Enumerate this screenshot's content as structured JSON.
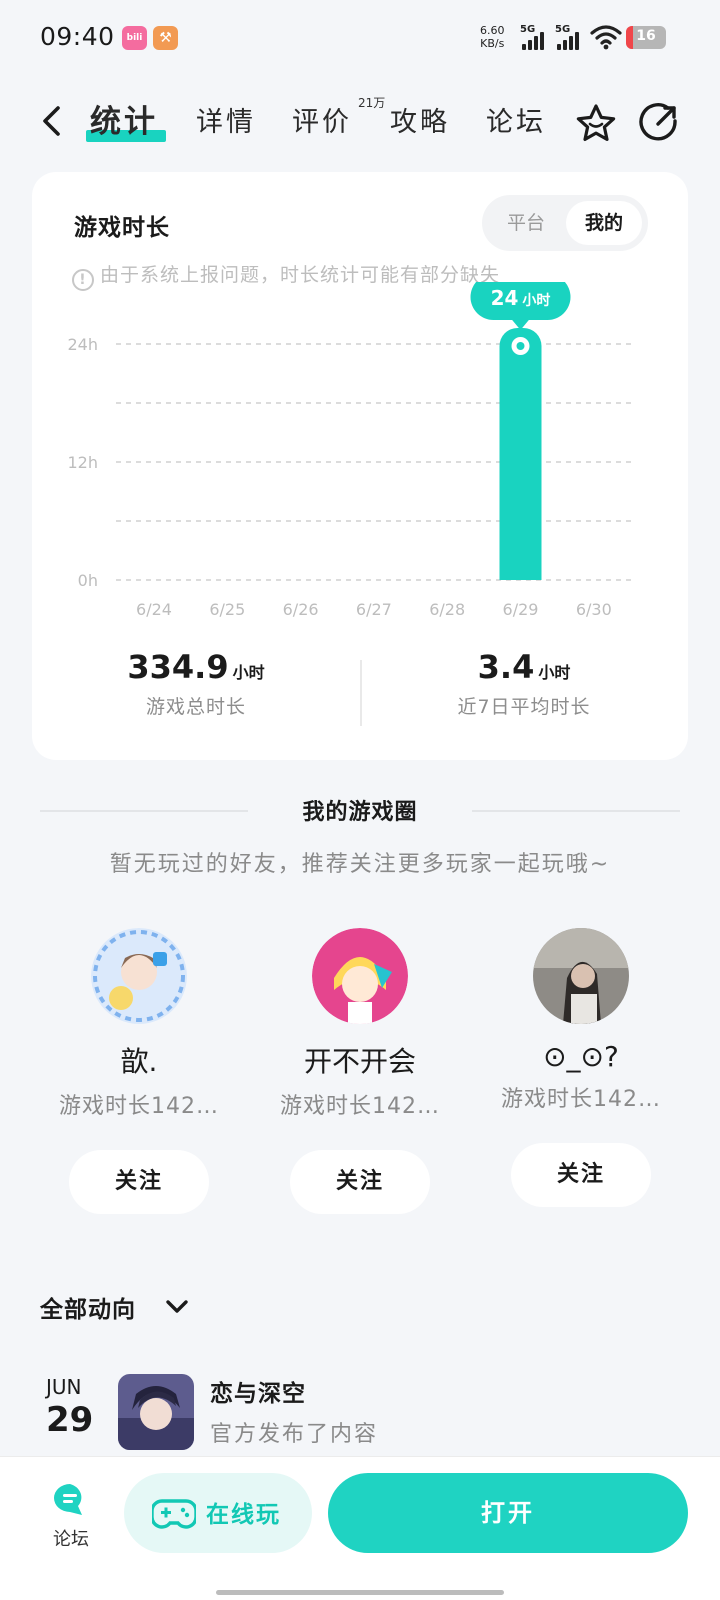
{
  "status": {
    "time": "09:40",
    "app_badge_1": "bili",
    "net_speed_value": "6.60",
    "net_speed_unit": "KB/s",
    "signal_1": "5G",
    "signal_2": "5G",
    "battery": "16"
  },
  "nav": {
    "tabs": [
      {
        "label": "统计",
        "active": true
      },
      {
        "label": "详情"
      },
      {
        "label": "评价",
        "badge": "21万"
      },
      {
        "label": "攻略"
      },
      {
        "label": "论坛"
      }
    ],
    "icons": [
      "back-icon",
      "star-icon",
      "share-icon"
    ]
  },
  "stats_card": {
    "title": "游戏时长",
    "toggle": {
      "options": [
        "平台",
        "我的"
      ],
      "selected": "我的"
    },
    "notice": "由于系统上报问题，时长统计可能有部分缺失",
    "total": {
      "value": "334.9",
      "unit": "小时",
      "label": "游戏总时长"
    },
    "average": {
      "value": "3.4",
      "unit": "小时",
      "label": "近7日平均时长"
    }
  },
  "chart_data": {
    "type": "bar",
    "categories": [
      "6/24",
      "6/25",
      "6/26",
      "6/27",
      "6/28",
      "6/29",
      "6/30"
    ],
    "values": [
      0,
      0,
      0,
      0,
      0,
      24,
      0
    ],
    "unit": "h",
    "ylim": [
      0,
      24
    ],
    "y_ticks": [
      "0h",
      "12h",
      "24h"
    ],
    "grid": true,
    "highlight": {
      "category": "6/29",
      "value": "24",
      "unit": "小时"
    },
    "bar_color": "#19d3c0"
  },
  "game_circle": {
    "title": "我的游戏圈",
    "subtitle": "暂无玩过的好友，推荐关注更多玩家一起玩哦~",
    "friends": [
      {
        "name": "歆.",
        "desc": "游戏时长142…",
        "follow_label": "关注"
      },
      {
        "name": "开不开会",
        "desc": "游戏时长142…",
        "follow_label": "关注"
      },
      {
        "name": "⊙_⊙?",
        "desc": "游戏时长142…",
        "follow_label": "关注"
      }
    ]
  },
  "dynamics": {
    "header": "全部动向",
    "items": [
      {
        "month": "JUN",
        "day": "29",
        "title": "恋与深空",
        "desc": "官方发布了内容"
      }
    ]
  },
  "bottom_bar": {
    "forum_label": "论坛",
    "play_online_label": "在线玩",
    "open_label": "打开"
  },
  "colors": {
    "accent": "#19d3c0",
    "background": "#f4f6f9"
  }
}
